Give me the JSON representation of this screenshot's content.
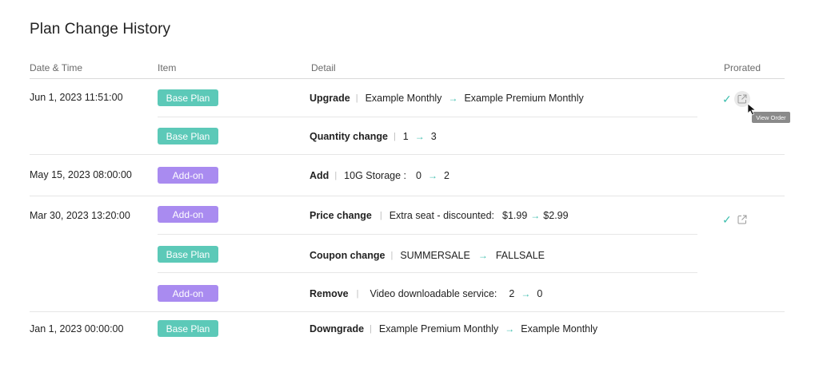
{
  "title": "Plan Change History",
  "headers": {
    "date": "Date & Time",
    "item": "Item",
    "detail": "Detail",
    "prorated": "Prorated"
  },
  "rows": [
    {
      "date": "Jun 1, 2023 11:51:00",
      "item": "Base Plan",
      "kind": "Upgrade",
      "label": "",
      "from": "Example Monthly",
      "to": "Example Premium Monthly"
    },
    {
      "date": "",
      "item": "Base Plan",
      "kind": "Quantity change",
      "label": "",
      "from": "1",
      "to": "3"
    },
    {
      "date": "May 15, 2023 08:00:00",
      "item": "Add-on",
      "kind": "Add",
      "label": "10G Storage :",
      "from": "0",
      "to": "2"
    },
    {
      "date": "Mar 30, 2023 13:20:00",
      "item": "Add-on",
      "kind": "Price change",
      "label": "Extra seat - discounted:",
      "from": "$1.99",
      "to": "$2.99"
    },
    {
      "date": "",
      "item": "Base Plan",
      "kind": "Coupon change",
      "label": "",
      "from": "SUMMERSALE",
      "to": "FALLSALE"
    },
    {
      "date": "",
      "item": "Add-on",
      "kind": "Remove",
      "label": "Video downloadable service:",
      "from": "2",
      "to": "0"
    },
    {
      "date": "Jan 1, 2023 00:00:00",
      "item": "Base Plan",
      "kind": "Downgrade",
      "label": "",
      "from": "Example Premium Monthly",
      "to": "Example Monthly"
    }
  ],
  "separator": "|",
  "arrow": "→",
  "check_glyph": "✓",
  "tooltip": "View Order",
  "colors": {
    "base_plan": "#5cc9b8",
    "add_on": "#a98bf0",
    "accent": "#3fbfae"
  },
  "icons": {
    "prorated": "check-icon",
    "view_order": "external-link-icon"
  }
}
